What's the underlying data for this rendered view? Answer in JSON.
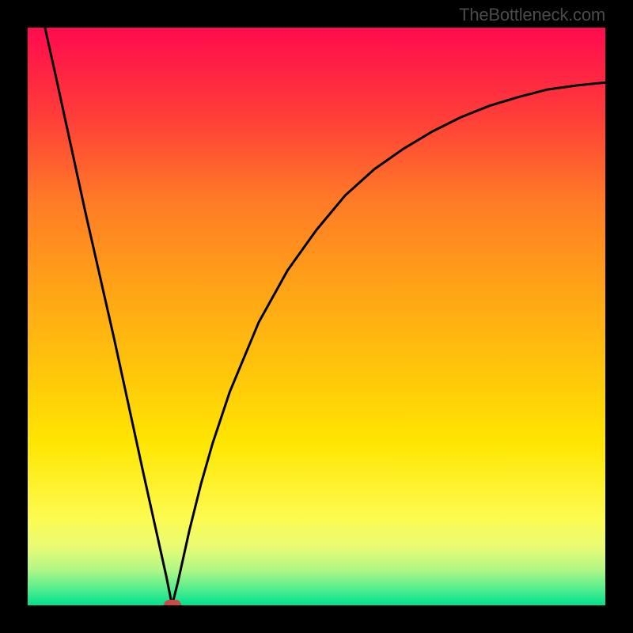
{
  "attribution": "TheBottleneck.com",
  "colors": {
    "frame": "#000000",
    "curve": "#000000",
    "marker": "#cd4948"
  },
  "chart_data": {
    "type": "line",
    "title": "",
    "xlabel": "",
    "ylabel": "",
    "xlim": [
      0,
      100
    ],
    "ylim": [
      0,
      100
    ],
    "grid": false,
    "legend": false,
    "series": [
      {
        "name": "bottleneck-curve",
        "x": [
          3,
          5,
          10,
          15,
          20,
          22,
          24,
          25,
          26,
          28,
          30,
          32,
          35,
          40,
          45,
          50,
          55,
          60,
          65,
          70,
          75,
          80,
          85,
          90,
          95,
          100
        ],
        "y": [
          100,
          91,
          68,
          46,
          23,
          14,
          5,
          0,
          4,
          13,
          21,
          28,
          37,
          49,
          58,
          65,
          71,
          75.5,
          79,
          82,
          84.5,
          86.5,
          88,
          89.3,
          90,
          90.5
        ]
      }
    ],
    "marker": {
      "x": 25,
      "y": 0
    },
    "gradient_stops": [
      {
        "pct": 0,
        "color": "#ff0b4e"
      },
      {
        "pct": 15,
        "color": "#ff3c39"
      },
      {
        "pct": 30,
        "color": "#ff7b26"
      },
      {
        "pct": 45,
        "color": "#ffa317"
      },
      {
        "pct": 60,
        "color": "#ffc70a"
      },
      {
        "pct": 72,
        "color": "#ffe602"
      },
      {
        "pct": 85,
        "color": "#fdfb51"
      },
      {
        "pct": 90,
        "color": "#e8fb75"
      },
      {
        "pct": 94,
        "color": "#aef786"
      },
      {
        "pct": 97,
        "color": "#59ee8d"
      },
      {
        "pct": 100,
        "color": "#00e18e"
      }
    ]
  }
}
